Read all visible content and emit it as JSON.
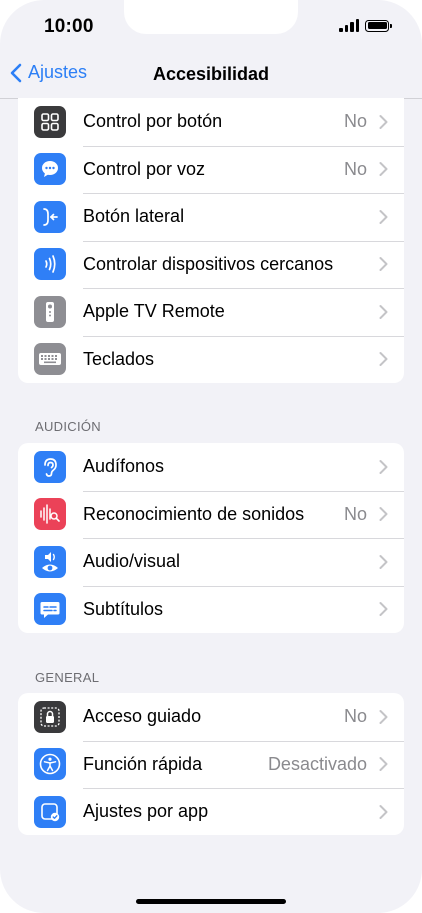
{
  "status_bar": {
    "time": "10:00"
  },
  "nav": {
    "back_label": "Ajustes",
    "title": "Accesibilidad"
  },
  "groups": [
    {
      "header": "",
      "rows": [
        {
          "label": "Control por botón",
          "value": "No"
        },
        {
          "label": "Control por voz",
          "value": "No"
        },
        {
          "label": "Botón lateral",
          "value": ""
        },
        {
          "label": "Controlar dispositivos cercanos",
          "value": ""
        },
        {
          "label": "Apple TV Remote",
          "value": ""
        },
        {
          "label": "Teclados",
          "value": ""
        }
      ]
    },
    {
      "header": "AUDICIÓN",
      "rows": [
        {
          "label": "Audífonos",
          "value": ""
        },
        {
          "label": "Reconocimiento de sonidos",
          "value": "No"
        },
        {
          "label": "Audio/visual",
          "value": ""
        },
        {
          "label": "Subtítulos",
          "value": ""
        }
      ]
    },
    {
      "header": "GENERAL",
      "rows": [
        {
          "label": "Acceso guiado",
          "value": "No"
        },
        {
          "label": "Función rápida",
          "value": "Desactivado"
        },
        {
          "label": "Ajustes por app",
          "value": ""
        }
      ]
    }
  ],
  "icons": {
    "switch_control": {
      "name": "switch-control-icon",
      "color": "#3a3a3c"
    },
    "voice_control": {
      "name": "voice-control-icon",
      "color": "#2f7ff6"
    },
    "side_button": {
      "name": "side-button-icon",
      "color": "#2f7ff6"
    },
    "nearby_devices": {
      "name": "nearby-devices-icon",
      "color": "#2f7ff6"
    },
    "tv_remote": {
      "name": "tv-remote-icon",
      "color": "#8e8e93"
    },
    "keyboards": {
      "name": "keyboard-icon",
      "color": "#8e8e93"
    },
    "hearing_devices": {
      "name": "ear-icon",
      "color": "#2f7ff6"
    },
    "sound_recognition": {
      "name": "sound-recognition-icon",
      "color": "#eb4258"
    },
    "audio_visual": {
      "name": "audio-visual-icon",
      "color": "#2f7ff6"
    },
    "subtitles": {
      "name": "subtitles-icon",
      "color": "#2f7ff6"
    },
    "guided_access": {
      "name": "lock-icon",
      "color": "#3a3a3c"
    },
    "shortcut": {
      "name": "accessibility-icon",
      "color": "#2f7ff6"
    },
    "per_app": {
      "name": "per-app-settings-icon",
      "color": "#2f7ff6"
    }
  },
  "colors": {
    "accent": "#2c7ff6",
    "background": "#f2f2f7",
    "secondary_text": "#8a8a8e"
  }
}
